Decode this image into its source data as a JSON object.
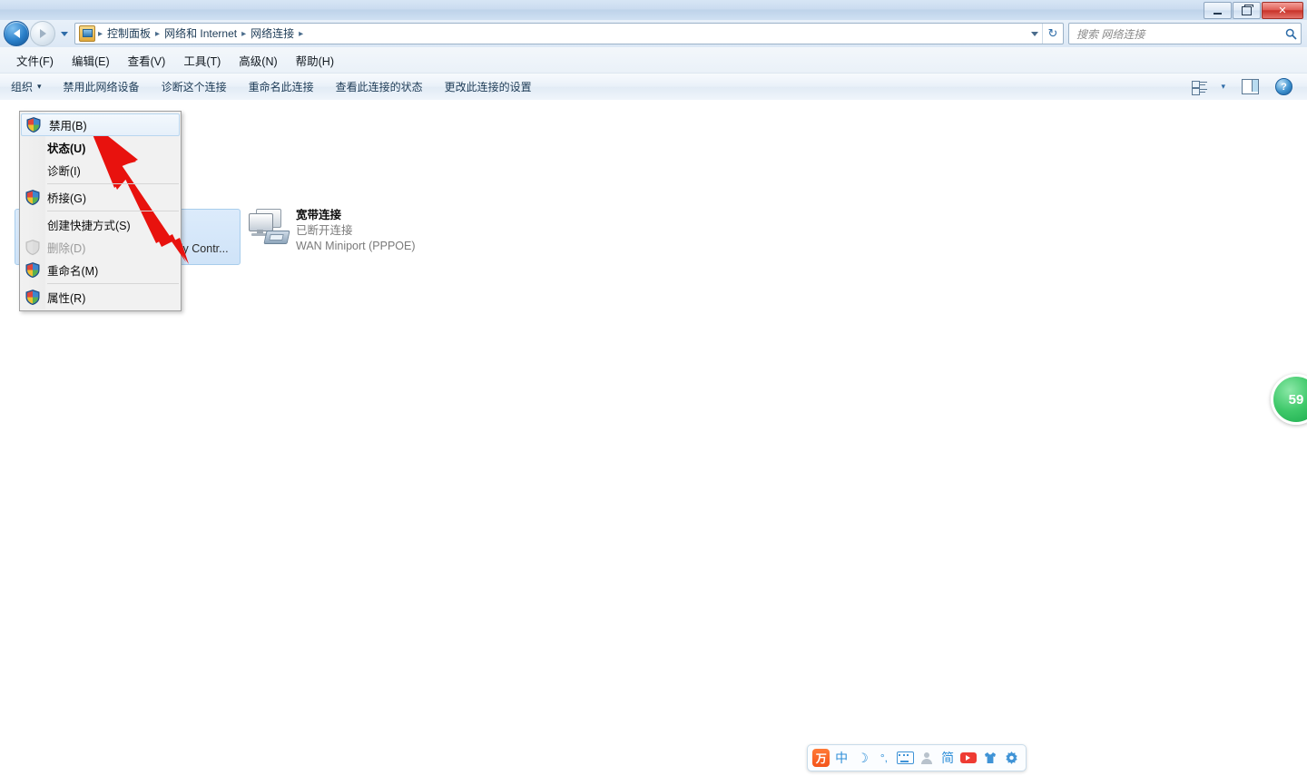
{
  "window": {
    "title": "",
    "controls": {
      "minimize": "minimize-button",
      "maximize": "maximize-button",
      "close": "✕"
    }
  },
  "navigation": {
    "back_tooltip": "后退",
    "forward_tooltip": "前进",
    "breadcrumb": [
      "控制面板",
      "网络和 Internet",
      "网络连接"
    ],
    "separator": "▸",
    "refresh_label": "↻"
  },
  "search": {
    "placeholder": "搜索 网络连接",
    "icon": "search-icon"
  },
  "menubar": {
    "items": [
      {
        "label": "文件(F)"
      },
      {
        "label": "编辑(E)"
      },
      {
        "label": "查看(V)"
      },
      {
        "label": "工具(T)"
      },
      {
        "label": "高级(N)"
      },
      {
        "label": "帮助(H)"
      }
    ]
  },
  "toolbar": {
    "organize_label": "组织",
    "organize_caret": "▾",
    "commands": [
      {
        "label": "禁用此网络设备"
      },
      {
        "label": "诊断这个连接"
      },
      {
        "label": "重命名此连接"
      },
      {
        "label": "查看此连接的状态"
      },
      {
        "label": "更改此连接的设置"
      }
    ],
    "right_icons": [
      {
        "name": "view-mode-icon"
      },
      {
        "name": "view-mode-caret",
        "glyph": "▾"
      },
      {
        "name": "preview-pane-icon"
      },
      {
        "name": "help-icon",
        "glyph": "?"
      }
    ]
  },
  "content": {
    "selected_item": {
      "name_fragment": "ily Contr...",
      "selected": true
    },
    "connections": [
      {
        "name": "宽带连接",
        "status": "已断开连接",
        "device": "WAN Miniport (PPPOE)",
        "icon": "network-connection-icon"
      }
    ]
  },
  "context_menu": {
    "items": [
      {
        "label": "禁用(B)",
        "icon": "shield-icon",
        "shield": true,
        "highlighted": true,
        "bold": false,
        "disabled": false
      },
      {
        "label": "状态(U)",
        "icon": "",
        "shield": false,
        "highlighted": false,
        "bold": true,
        "disabled": false
      },
      {
        "label": "诊断(I)",
        "icon": "",
        "shield": false,
        "highlighted": false,
        "bold": false,
        "disabled": false
      },
      {
        "separator": true
      },
      {
        "label": "桥接(G)",
        "icon": "shield-icon",
        "shield": true,
        "highlighted": false,
        "bold": false,
        "disabled": false
      },
      {
        "separator": true
      },
      {
        "label": "创建快捷方式(S)",
        "icon": "",
        "shield": false,
        "highlighted": false,
        "bold": false,
        "disabled": false
      },
      {
        "label": "删除(D)",
        "icon": "shield-icon-disabled",
        "shield": true,
        "highlighted": false,
        "bold": false,
        "disabled": true
      },
      {
        "label": "重命名(M)",
        "icon": "shield-icon",
        "shield": true,
        "highlighted": false,
        "bold": false,
        "disabled": false
      },
      {
        "separator": true
      },
      {
        "label": "属性(R)",
        "icon": "shield-icon",
        "shield": true,
        "highlighted": false,
        "bold": false,
        "disabled": false
      }
    ]
  },
  "annotation": {
    "type": "red-arrow",
    "color": "#e8120e",
    "points_to": "禁用(B)"
  },
  "side_badge": {
    "text": "59",
    "color": "#2fbf5e"
  },
  "ime_bar": {
    "items": [
      {
        "name": "ime-logo",
        "label": "万"
      },
      {
        "name": "ime-chinese-mode",
        "label": "中"
      },
      {
        "name": "ime-moon-icon",
        "label": "☽"
      },
      {
        "name": "ime-punctuation-icon",
        "label": "°,"
      },
      {
        "name": "ime-soft-keyboard-icon",
        "label": ""
      },
      {
        "name": "ime-user-icon",
        "label": ""
      },
      {
        "name": "ime-simplified-icon",
        "label": "简"
      },
      {
        "name": "ime-video-icon",
        "label": ""
      },
      {
        "name": "ime-skin-icon",
        "label": ""
      },
      {
        "name": "ime-settings-icon",
        "label": "✿"
      }
    ]
  }
}
